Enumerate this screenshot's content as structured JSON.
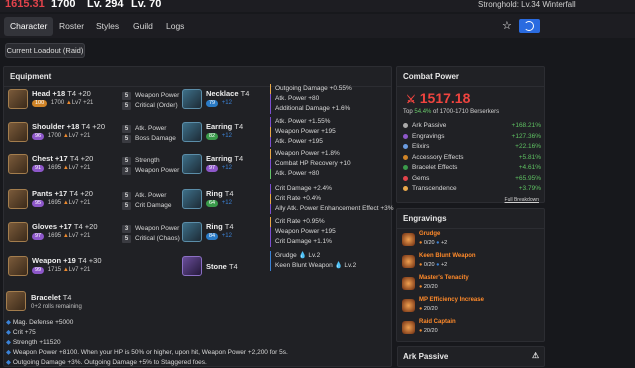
{
  "topbar": {
    "item_level": "1615.31",
    "gear_score": "1700",
    "level": "Lv. 294",
    "combat_level": "Lv. 70",
    "stronghold": "Stronghold: Lv.34 Winterfall"
  },
  "nav": {
    "tabs": [
      "Character",
      "Roster",
      "Styles",
      "Guild",
      "Logs"
    ],
    "active": "Character"
  },
  "loadout": "Current Loadout (Raid)",
  "equipment": {
    "title": "Equipment",
    "items": [
      {
        "name": "Head +18",
        "tier": "T4",
        "quality_plus": "+20",
        "q": "100",
        "score": "1700",
        "lv": "Lv7 +21",
        "lines": [
          [
            "5",
            "Weapon Power"
          ],
          [
            "5",
            "Critical (Order)"
          ]
        ]
      },
      {
        "name": "Shoulder +18",
        "tier": "T4",
        "quality_plus": "+20",
        "q": "96",
        "score": "1700",
        "lv": "Lv7 +21",
        "lines": [
          [
            "5",
            "Atk. Power"
          ],
          [
            "5",
            "Boss Damage"
          ]
        ]
      },
      {
        "name": "Chest +17",
        "tier": "T4",
        "quality_plus": "+20",
        "q": "91",
        "score": "1695",
        "lv": "Lv7 +21",
        "lines": [
          [
            "5",
            "Strength"
          ],
          [
            "3",
            "Weapon Power"
          ]
        ]
      },
      {
        "name": "Pants +17",
        "tier": "T4",
        "quality_plus": "+20",
        "q": "95",
        "score": "1695",
        "lv": "Lv7 +21",
        "lines": [
          [
            "5",
            "Atk. Power"
          ],
          [
            "5",
            "Crit Damage"
          ]
        ]
      },
      {
        "name": "Gloves +17",
        "tier": "T4",
        "quality_plus": "+20",
        "q": "97",
        "score": "1695",
        "lv": "Lv7 +21",
        "lines": [
          [
            "3",
            "Weapon Power"
          ],
          [
            "5",
            "Critical (Chaos)"
          ]
        ]
      },
      {
        "name": "Weapon +19",
        "tier": "T4",
        "quality_plus": "+30",
        "q": "99",
        "score": "1715",
        "lv": "Lv7 +21",
        "lines": []
      }
    ],
    "accessories": [
      {
        "name": "Necklace",
        "tier": "T4",
        "q": "79",
        "plus": "+12",
        "effects": [
          "Outgoing Damage +0.55%",
          "Atk. Power +80",
          "Additional Damage +1.6%"
        ]
      },
      {
        "name": "Earring",
        "tier": "T4",
        "q": "82",
        "plus": "+12",
        "effects": [
          "Atk. Power +1.55%",
          "Weapon Power +195",
          "Atk. Power +195"
        ]
      },
      {
        "name": "Earring",
        "tier": "T4",
        "q": "97",
        "plus": "+12",
        "effects": [
          "Weapon Power +1.8%",
          "Combat HP Recovery +10",
          "Atk. Power +80"
        ]
      },
      {
        "name": "Ring",
        "tier": "T4",
        "q": "64",
        "plus": "+12",
        "effects": [
          "Crit Damage +2.4%",
          "Crit Rate +0.4%",
          "Ally Atk. Power Enhancement Effect +3%"
        ]
      },
      {
        "name": "Ring",
        "tier": "T4",
        "q": "84",
        "plus": "+12",
        "effects": [
          "Crit Rate +0.95%",
          "Weapon Power +195",
          "Crit Damage +1.1%"
        ]
      },
      {
        "name": "Stone",
        "tier": "T4",
        "effects": [
          "Grudge 💧 Lv.2",
          "Keen Blunt Weapon 💧 Lv.2"
        ]
      }
    ],
    "bracelet": {
      "name": "Bracelet",
      "tier": "T4",
      "rolls": "0+2 rolls remaining",
      "lines": [
        "Mag. Defense +5000",
        "Crit +75",
        "Strength +11520",
        "Weapon Power +8100. When your HP is 50% or higher, upon hit, Weapon Power +2,200 for 5s.",
        "Outgoing Damage +3%. Outgoing Damage +5% to Staggered foes."
      ]
    }
  },
  "combat_power": {
    "title": "Combat Power",
    "value": "1517.18",
    "subtitle_pre": "Top",
    "subtitle_pct": "54.4%",
    "subtitle_post": "of 1700-1710 Berserkers",
    "rows": [
      [
        "Ark Passive",
        "+168.21%"
      ],
      [
        "Engravings",
        "+127.36%"
      ],
      [
        "Elixirs",
        "+22.16%"
      ],
      [
        "Accessory Effects",
        "+5.81%"
      ],
      [
        "Bracelet Effects",
        "+4.61%"
      ],
      [
        "Gems",
        "+65.95%"
      ],
      [
        "Transcendence",
        "+3.79%"
      ]
    ],
    "breakdown_link": "Full Breakdown"
  },
  "engravings": {
    "title": "Engravings",
    "items": [
      {
        "name": "Grudge",
        "stat": "0/20",
        "extra": "+2"
      },
      {
        "name": "Keen Blunt Weapon",
        "stat": "0/20",
        "extra": "+2"
      },
      {
        "name": "Master's Tenacity",
        "stat": "20/20",
        "extra": ""
      },
      {
        "name": "MP Efficiency Increase",
        "stat": "20/20",
        "extra": ""
      },
      {
        "name": "Raid Captain",
        "stat": "20/20",
        "extra": ""
      }
    ]
  },
  "ark_passive": {
    "title": "Ark Passive"
  },
  "colors": {
    "accent": "#2a6be0",
    "cp_red": "#f0443f",
    "positive": "#5ec162",
    "engraving": "#ff8a2a"
  }
}
